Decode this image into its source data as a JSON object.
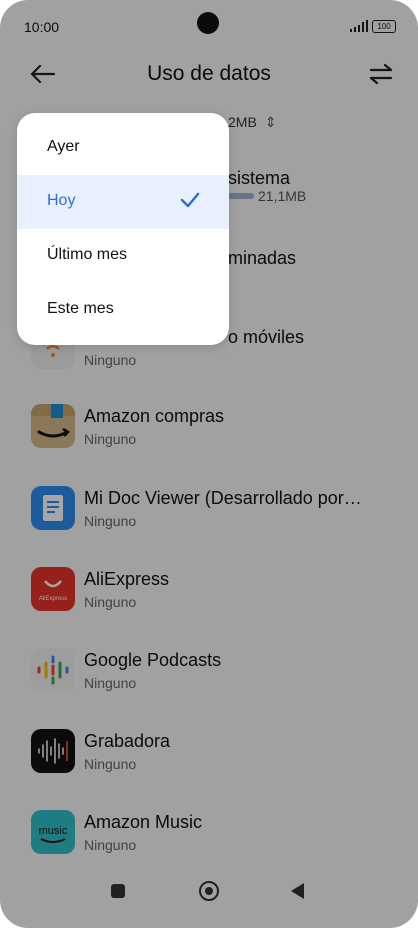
{
  "status": {
    "time": "10:00",
    "battery": "100"
  },
  "header": {
    "title": "Uso de datos"
  },
  "summary": {
    "value": "2MB"
  },
  "rows": [
    {
      "name": "sistema",
      "bar_value": "21,1MB"
    },
    {
      "name": "minadas"
    },
    {
      "name": "o móviles",
      "sub": "Ninguno"
    },
    {
      "name": "Amazon compras",
      "sub": "Ninguno"
    },
    {
      "name": "Mi Doc Viewer (Desarrollado por…",
      "sub": "Ninguno"
    },
    {
      "name": "AliExpress",
      "sub": "Ninguno"
    },
    {
      "name": "Google Podcasts",
      "sub": "Ninguno"
    },
    {
      "name": "Grabadora",
      "sub": "Ninguno"
    },
    {
      "name": "Amazon Music",
      "sub": "Ninguno"
    }
  ],
  "icons": {
    "aliexpress_text": "AliExpress",
    "music_text": "music"
  },
  "menu": {
    "options": [
      {
        "label": "Ayer"
      },
      {
        "label": "Hoy"
      },
      {
        "label": "Último mes"
      },
      {
        "label": "Este mes"
      }
    ],
    "selected_index": 1,
    "accent": "#2f6ddc"
  }
}
